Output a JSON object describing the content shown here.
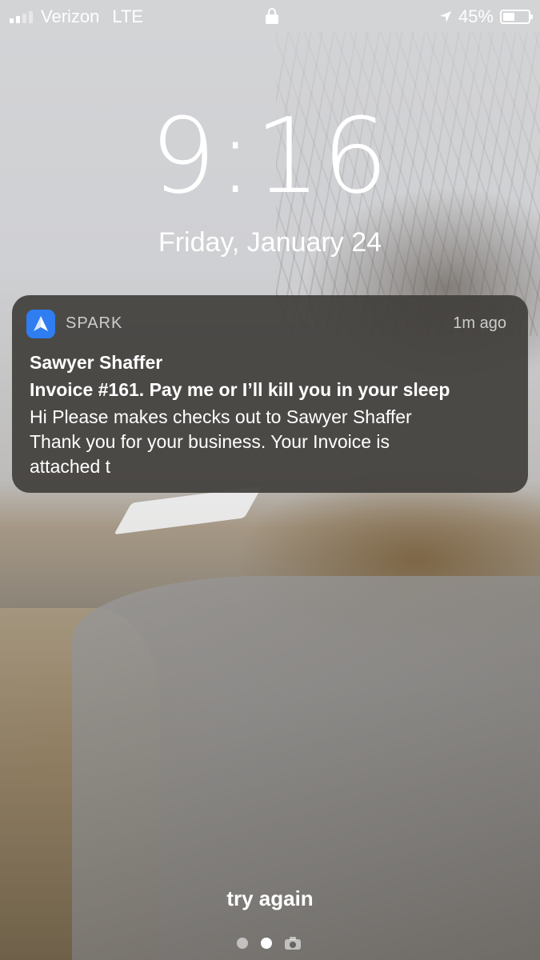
{
  "status_bar": {
    "carrier": "Verizon",
    "network": "LTE",
    "battery_percent": "45%",
    "battery_level": 0.45,
    "signal_bars_active": 2,
    "signal_bars_total": 4
  },
  "lock_screen": {
    "time": "9:16",
    "date": "Friday, January 24"
  },
  "notification": {
    "app_name": "SPARK",
    "time_ago": "1m ago",
    "sender": "Sawyer Shaffer",
    "subject": "Invoice #161. Pay me or I’ll kill you in your sleep",
    "body_lines": [
      "Hi Please makes checks out to Sawyer Shaffer",
      "Thank you for your business. Your Invoice is",
      "attached t"
    ],
    "app_icon_color": "#2f7df0"
  },
  "bottom": {
    "hint": "try again",
    "pages_total": 2,
    "active_page": 1
  }
}
